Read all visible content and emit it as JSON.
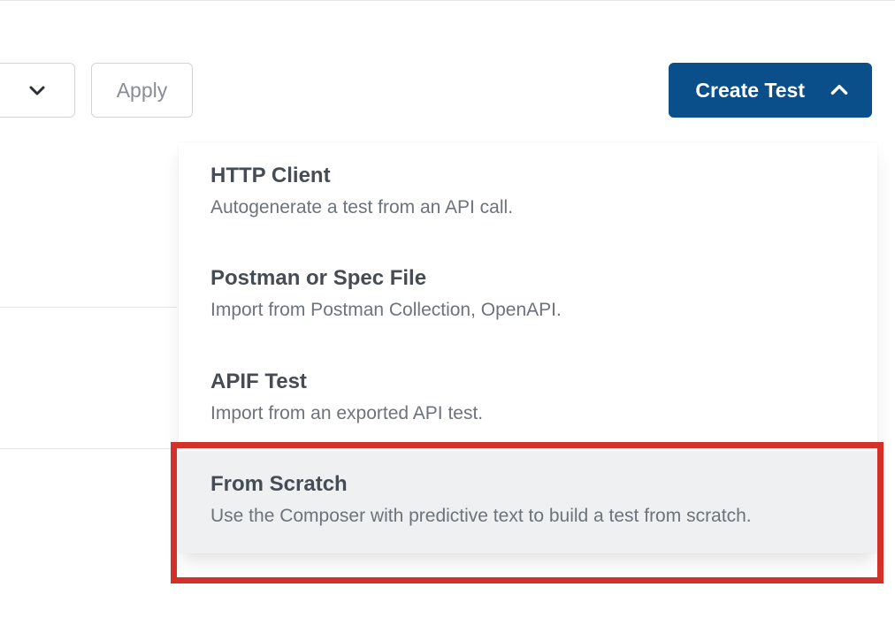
{
  "toolbar": {
    "apply_label": "Apply",
    "create_test_label": "Create Test"
  },
  "menu": {
    "items": [
      {
        "title": "HTTP Client",
        "desc": "Autogenerate a test from an API call."
      },
      {
        "title": "Postman or Spec File",
        "desc": "Import from Postman Collection, OpenAPI."
      },
      {
        "title": "APIF Test",
        "desc": "Import from an exported API test."
      },
      {
        "title": "From Scratch",
        "desc": "Use the Composer with predictive text to build a test from scratch."
      }
    ]
  }
}
